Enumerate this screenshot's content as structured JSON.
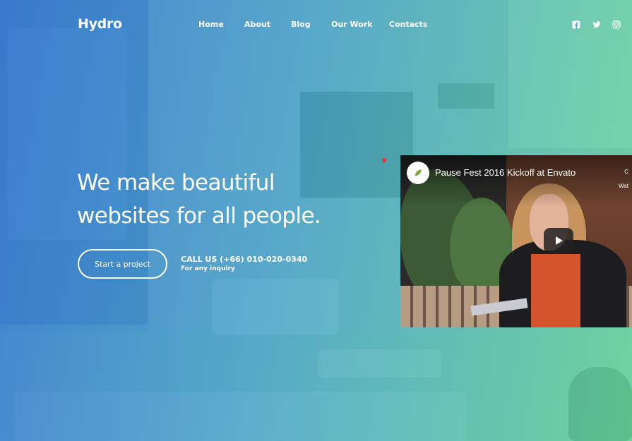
{
  "brand": {
    "logo": "Hydro"
  },
  "nav": {
    "items": [
      {
        "label": "Home"
      },
      {
        "label": "About"
      },
      {
        "label": "Blog"
      },
      {
        "label": "Our Work"
      },
      {
        "label": "Contacts"
      }
    ]
  },
  "social": [
    {
      "icon": "facebook-icon"
    },
    {
      "icon": "twitter-icon"
    },
    {
      "icon": "instagram-icon"
    }
  ],
  "hero": {
    "headline_line1": "We make beautiful",
    "headline_line2": "websites for all people.",
    "cta_label": "Start a project",
    "call_text": "CALL US (+66) 010-020-0340",
    "call_sub": "For any inquiry"
  },
  "video": {
    "title": "Pause Fest 2016 Kickoff at Envato",
    "side_top": "C",
    "side_bottom": "Wat",
    "play_icon": "play-icon",
    "channel_icon": "envato-leaf-icon"
  },
  "colors": {
    "gradient_start": "#3478d2",
    "gradient_end": "#62d496",
    "accent_dot": "#e0383e"
  }
}
